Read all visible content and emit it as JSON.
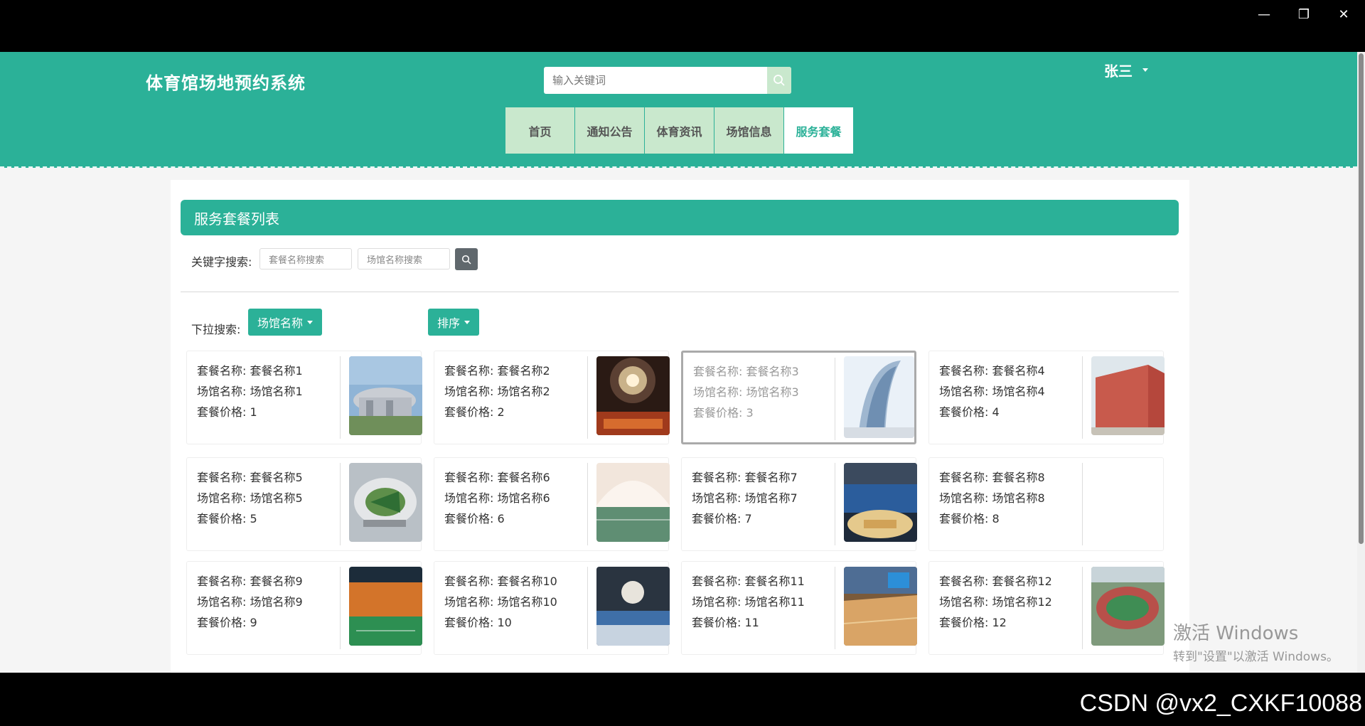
{
  "header": {
    "site_title": "体育馆场地预约系统",
    "search_placeholder": "输入关键词",
    "user_name": "张三",
    "nav": [
      {
        "label": "首页",
        "active": false
      },
      {
        "label": "通知公告",
        "active": false
      },
      {
        "label": "体育资讯",
        "active": false
      },
      {
        "label": "场馆信息",
        "active": false
      },
      {
        "label": "服务套餐",
        "active": true
      }
    ]
  },
  "page": {
    "panel_title": "服务套餐列表",
    "keyword_label": "关键字搜索:",
    "keyword_placeholder_1": "套餐名称搜索",
    "keyword_placeholder_2": "场馆名称搜索",
    "dropdown_label": "下拉搜索:",
    "dropdown_venue": "场馆名称",
    "dropdown_sort": "排序"
  },
  "cards": [
    {
      "name": "套餐名称: 套餐名称1",
      "venue": "场馆名称: 场馆名称1",
      "price": "套餐价格: 1",
      "image": "modern-stadium-photo"
    },
    {
      "name": "套餐名称: 套餐名称2",
      "venue": "场馆名称: 场馆名称2",
      "price": "套餐价格: 2",
      "image": "arena-interior-photo"
    },
    {
      "name": "套餐名称: 套餐名称3",
      "venue": "场馆名称: 场馆名称3",
      "price": "套餐价格: 3",
      "image": "curved-glass-building-photo"
    },
    {
      "name": "套餐名称: 套餐名称4",
      "venue": "场馆名称: 场馆名称4",
      "price": "套餐价格: 4",
      "image": "red-gymnasium-photo"
    },
    {
      "name": "套餐名称: 套餐名称5",
      "venue": "场馆名称: 场馆名称5",
      "price": "套餐价格: 5",
      "image": "stadium-model-photo"
    },
    {
      "name": "套餐名称: 套餐名称6",
      "venue": "场馆名称: 场馆名称6",
      "price": "套餐价格: 6",
      "image": "dome-court-photo"
    },
    {
      "name": "套餐名称: 套餐名称7",
      "venue": "场馆名称: 场馆名称7",
      "price": "套餐价格: 7",
      "image": "basketball-arena-photo"
    },
    {
      "name": "套餐名称: 套餐名称8",
      "venue": "场馆名称: 场馆名称8",
      "price": "套餐价格: 8",
      "image": ""
    },
    {
      "name": "套餐名称: 套餐名称9",
      "venue": "场馆名称: 场馆名称9",
      "price": "套餐价格: 9",
      "image": "badminton-hall-photo"
    },
    {
      "name": "套餐名称: 套餐名称10",
      "venue": "场馆名称: 场馆名称10",
      "price": "套餐价格: 10",
      "image": "indoor-arena-photo"
    },
    {
      "name": "套餐名称: 套餐名称11",
      "venue": "场馆名称: 场馆名称11",
      "price": "套餐价格: 11",
      "image": "wood-court-photo"
    },
    {
      "name": "套餐名称: 套餐名称12",
      "venue": "场馆名称: 场馆名称12",
      "price": "套餐价格: 12",
      "image": "aerial-stadium-photo"
    }
  ],
  "overlay": {
    "activate_line1": "激活 Windows",
    "activate_line2": "转到\"设置\"以激活 Windows。",
    "watermark": "CSDN @vx2_CXKF10088"
  },
  "colors": {
    "primary": "#2bb198",
    "nav_bg": "#c9e8cd"
  }
}
